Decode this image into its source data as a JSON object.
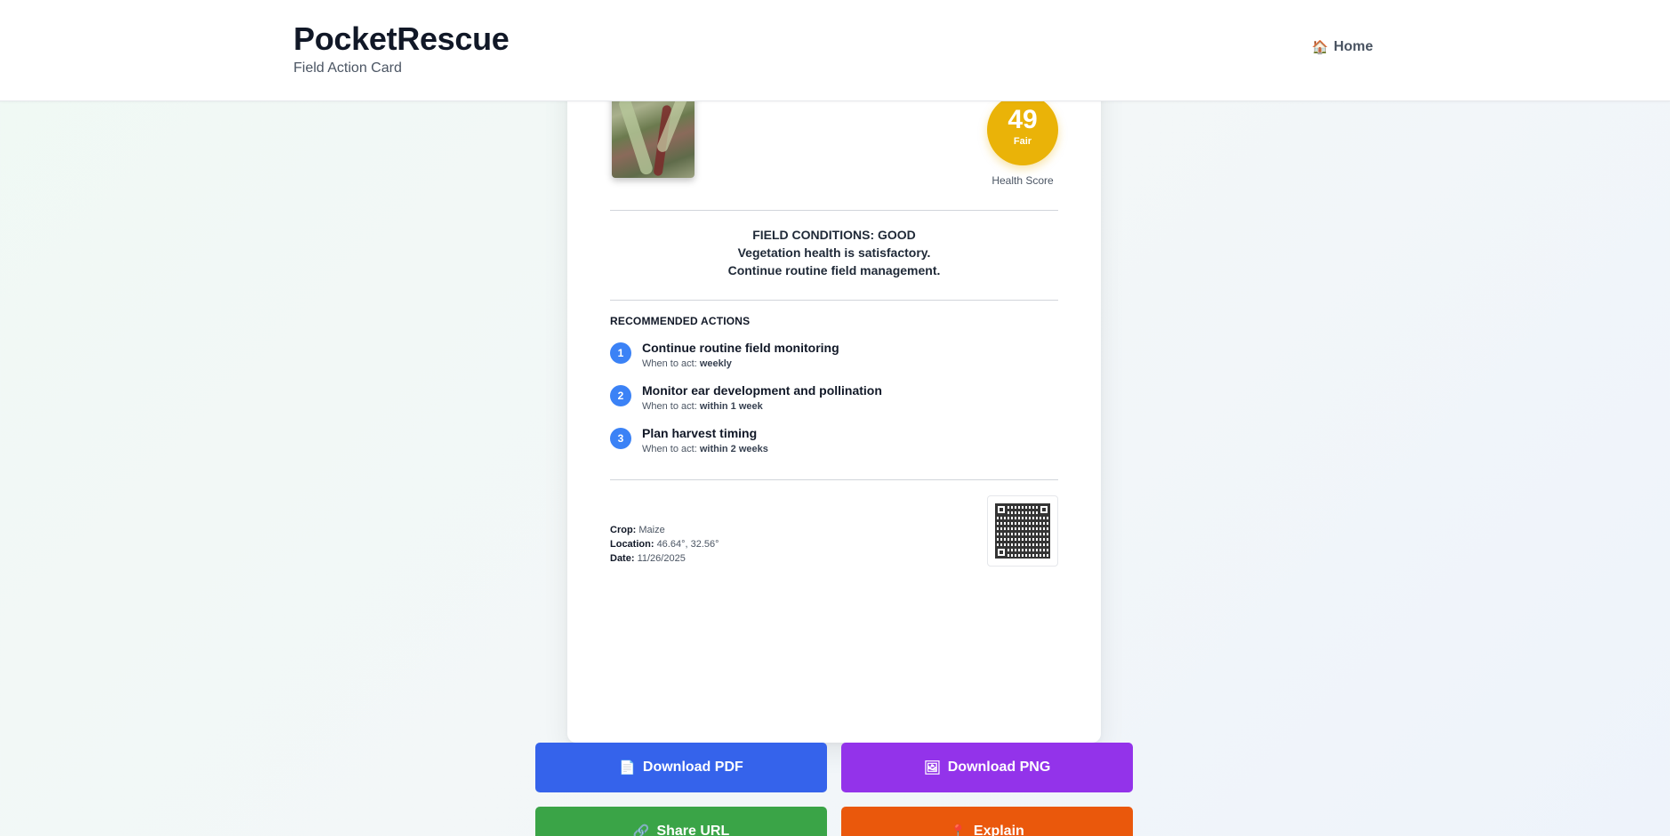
{
  "header": {
    "title": "PocketRescue",
    "subtitle": "Field Action Card",
    "nav_home_icon": "house-icon",
    "nav_home_label": "Home"
  },
  "card": {
    "health_score": {
      "value": "49",
      "rating": "Fair",
      "caption": "Health Score",
      "color": "#eab308"
    },
    "conditions": {
      "line1": "FIELD CONDITIONS: GOOD",
      "line2": "Vegetation health is satisfactory.",
      "line3": "Continue routine field management."
    },
    "actions_title": "RECOMMENDED ACTIONS",
    "when_prefix": "When to act:",
    "actions": [
      {
        "num": "1",
        "title": "Continue routine field monitoring",
        "when": "weekly"
      },
      {
        "num": "2",
        "title": "Monitor ear development and pollination",
        "when": "within 1 week"
      },
      {
        "num": "3",
        "title": "Plan harvest timing",
        "when": "within 2 weeks"
      }
    ],
    "meta": {
      "crop_label": "Crop:",
      "crop_value": "Maize",
      "location_label": "Location:",
      "location_value": "46.64°, 32.56°",
      "date_label": "Date:",
      "date_value": "11/26/2025"
    }
  },
  "buttons": {
    "pdf": "Download PDF",
    "png": "Download PNG",
    "share": "Share URL",
    "explain": "Explain"
  },
  "colors": {
    "pdf": "#3563eb",
    "png": "#9333ea",
    "share": "#3aa447",
    "explain": "#ea580c",
    "step_badge": "#3b82f6"
  }
}
